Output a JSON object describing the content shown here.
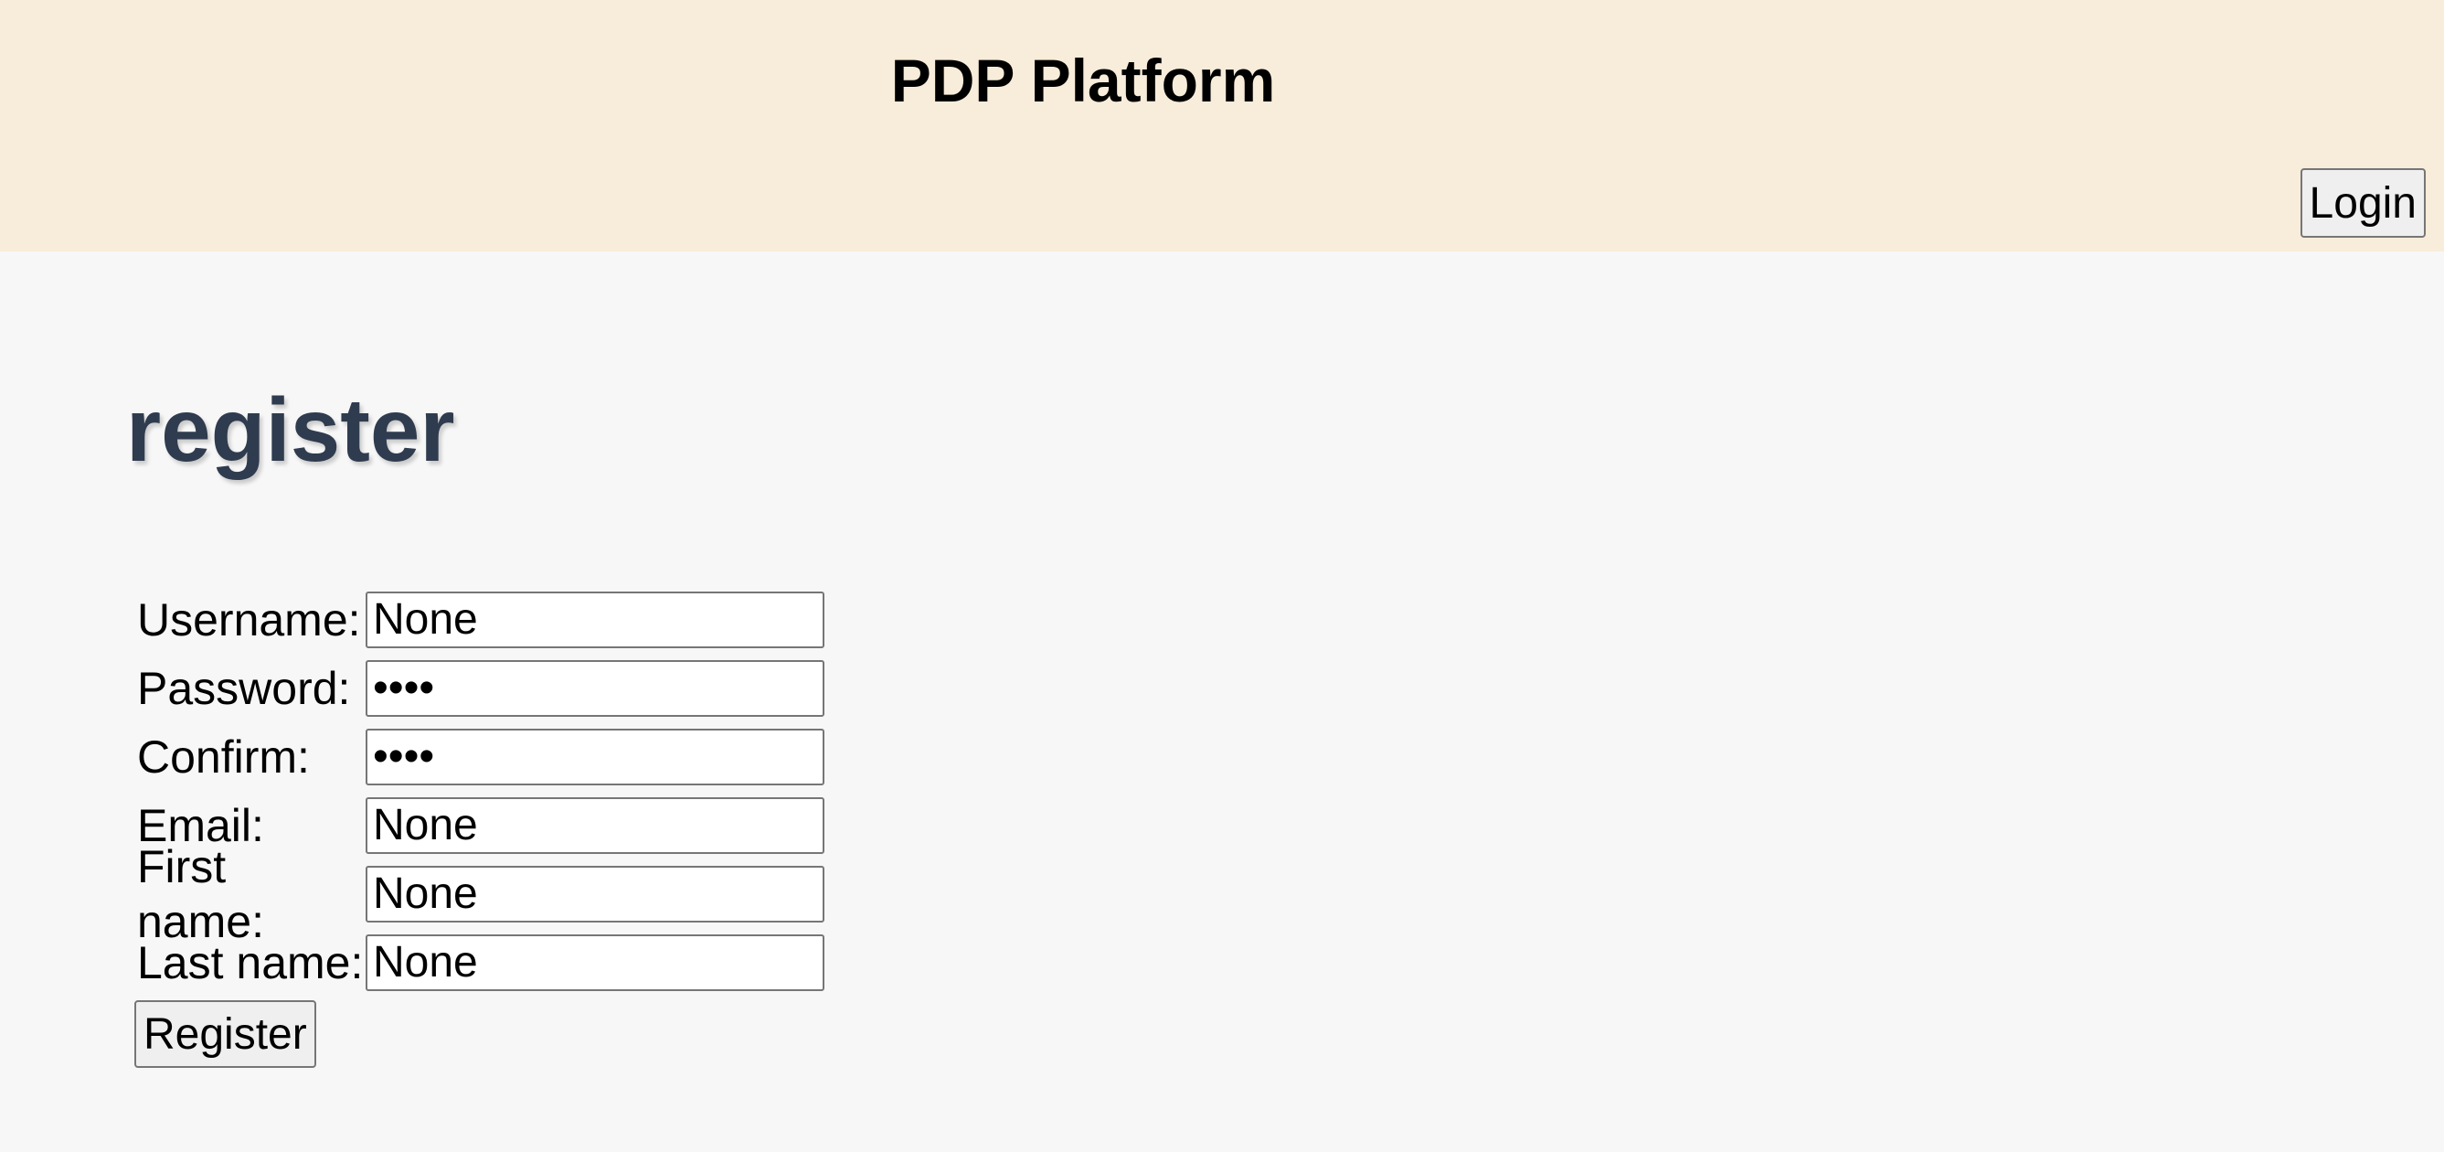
{
  "header": {
    "title": "PDP Platform",
    "login_label": "Login"
  },
  "page": {
    "title": "register"
  },
  "form": {
    "fields": [
      {
        "label": "Username:",
        "value": "None",
        "type": "text"
      },
      {
        "label": "Password:",
        "value": "None",
        "type": "password"
      },
      {
        "label": "Confirm:",
        "value": "None",
        "type": "password"
      },
      {
        "label": "Email:",
        "value": "None",
        "type": "text"
      },
      {
        "label": "First name:",
        "value": "None",
        "type": "text"
      },
      {
        "label": "Last name:",
        "value": "None",
        "type": "text"
      }
    ],
    "submit_label": "Register"
  },
  "colors": {
    "header_bg": "#f8ecda",
    "page_bg": "#f7f7f7",
    "title": "#2f3c4f"
  }
}
